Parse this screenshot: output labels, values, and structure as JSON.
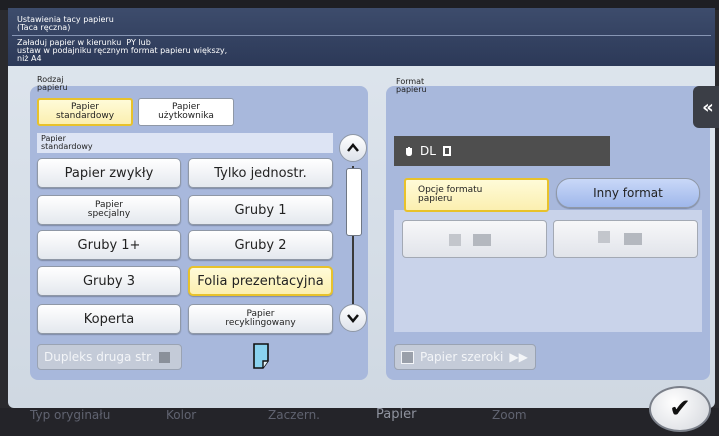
{
  "header": {
    "title": "Ustawienia tacy papieru\n(Taca ręczna)",
    "message": "Załaduj papier w kierunku  PY lub\nustaw w podajniku ręcznym format papieru większy,\nniż A4"
  },
  "paper_type": {
    "label": "Rodzaj\npapieru",
    "tabs": [
      "Papier\nstandardowy",
      "Papier\nużytkownika"
    ],
    "selected_tab": "Papier\nstandardowy",
    "list_header": "Papier\nstandardowy",
    "options": [
      "Papier zwykły",
      "Tylko jednostr.",
      "Papier\nspecjalny",
      "Gruby 1",
      "Gruby 1+",
      "Gruby 2",
      "Gruby 3",
      "Folia prezentacyjna",
      "Koperta",
      "Papier\nrecyklingowany"
    ],
    "selected_option": "Folia prezentacyjna",
    "duplex_label": "Dupleks druga str."
  },
  "paper_format": {
    "label": "Format\npapieru",
    "current": "DL",
    "tabs": [
      "Opcje formatu\npapieru",
      "Inny format"
    ],
    "selected_tab": "Opcje formatu\npapieru",
    "wide_label": "Papier szeroki"
  },
  "bottom_nav": [
    "Typ oryginału",
    "Kolor",
    "Zaczern.",
    "Papier",
    "Zoom"
  ],
  "bottom_nav_active": "Papier",
  "colors": {
    "header_bg": "#2e3b5a",
    "section_bg": "#a8b8dc",
    "selected_border": "#e8c22b",
    "selected_fill": "#fdf5c0"
  },
  "icons": {
    "scroll_up": "chevron-up-icon",
    "scroll_down": "chevron-down-icon",
    "back": "double-chevron-left-icon",
    "ok": "checkmark-icon",
    "transparency": "transparency-sheet-icon",
    "hand": "hand-icon",
    "wide_arrow": "double-arrow-right-icon"
  }
}
